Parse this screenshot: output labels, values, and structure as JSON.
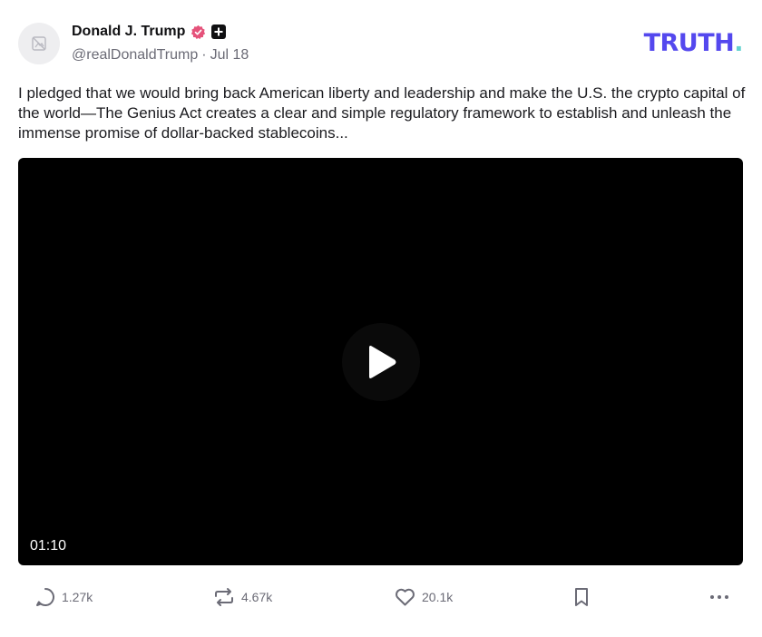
{
  "author": {
    "display_name": "Donald J. Trump",
    "handle": "@realDonaldTrump",
    "date_sep": "·",
    "date": "Jul 18",
    "verified_color": "#e5527a"
  },
  "brand": {
    "logo_text": "TRUTH",
    "logo_dot": ".",
    "logo_color": "#5448ee",
    "dot_color": "#65d3d0"
  },
  "post": {
    "text": "I pledged that we would bring back American liberty and leadership and make the U.S. the crypto capital of the world—The Genius Act creates a clear and simple regulatory framework to establish and unleash the immense promise of dollar-backed stablecoins..."
  },
  "video": {
    "duration": "01:10",
    "play_icon": "play-icon"
  },
  "actions": {
    "replies": "1.27k",
    "reposts": "4.67k",
    "likes": "20.1k",
    "icons": [
      "comment-icon",
      "repost-icon",
      "heart-icon",
      "bookmark-icon",
      "more-icon"
    ]
  }
}
